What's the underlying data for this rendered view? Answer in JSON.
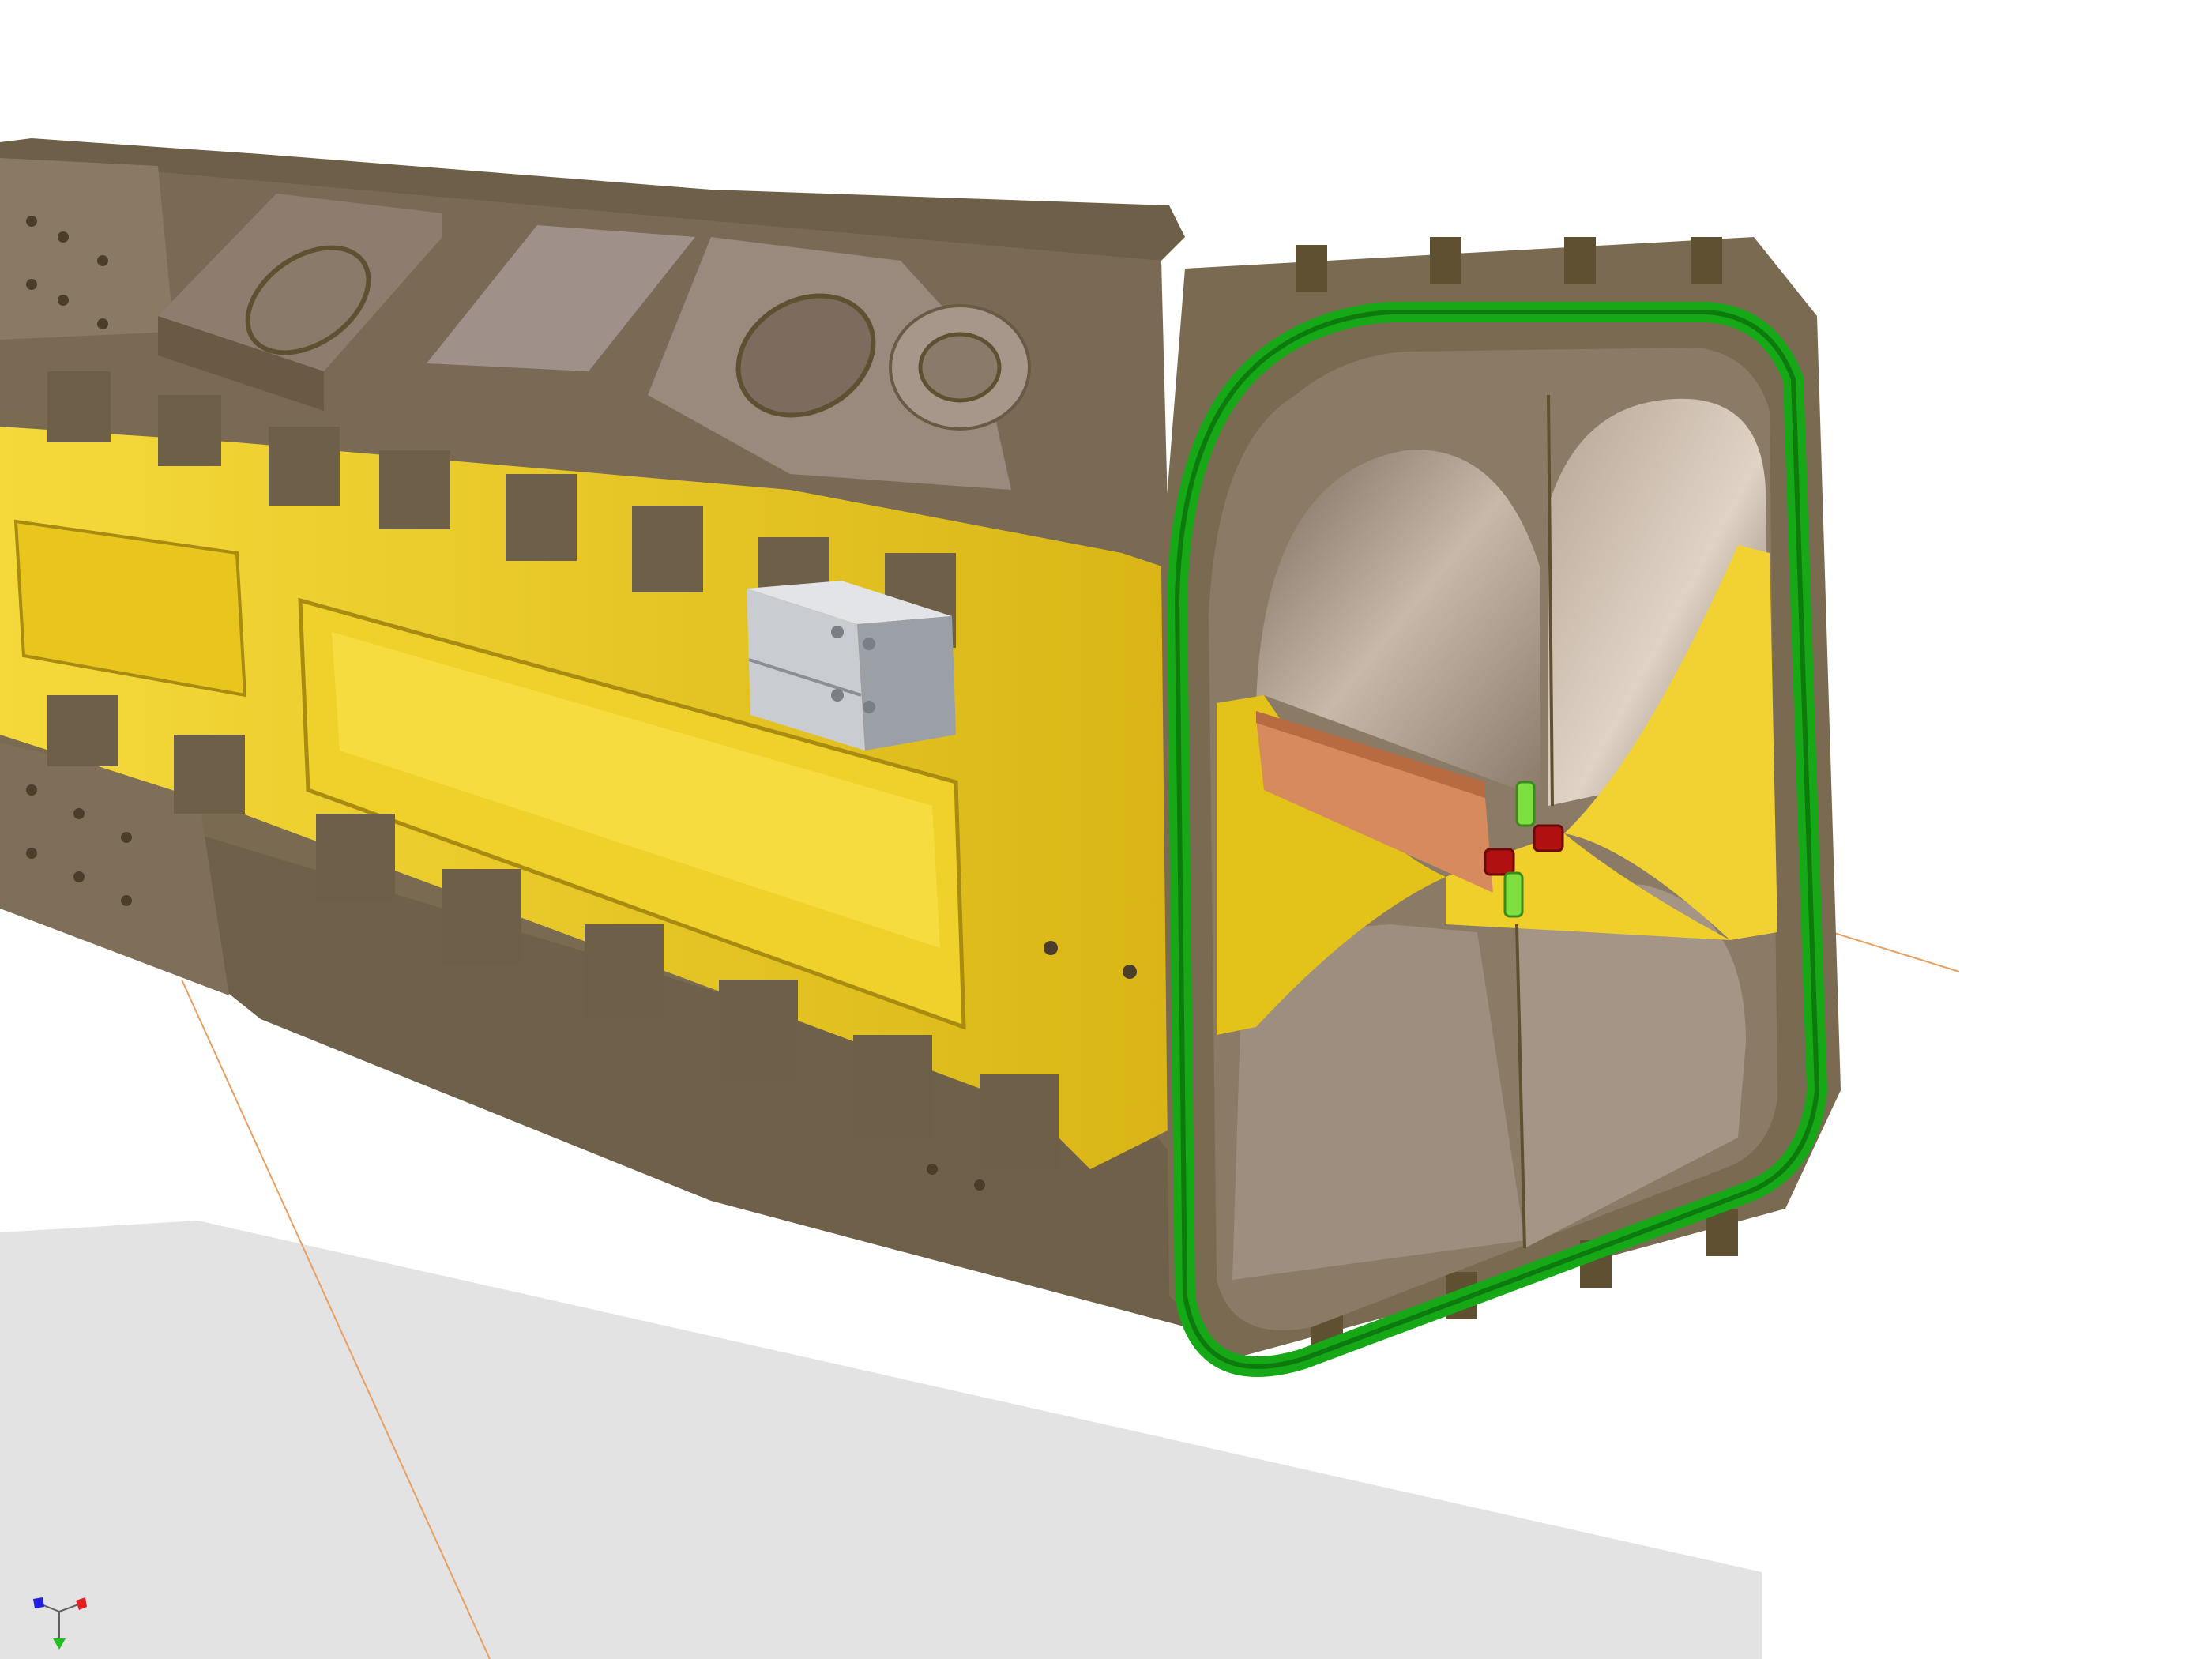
{
  "viewport": {
    "background": "#ffffff",
    "shadow_color": "#e3e3e3"
  },
  "model": {
    "part": "cryomodule-collar-quadrupole-section",
    "colors": {
      "body_top_face": "#9b8a7c",
      "body_face": "#8a7965",
      "body_dark": "#5f5032",
      "body_mid": "#7a6a52",
      "yellow_light": "#f2d233",
      "yellow_mid": "#e3c21a",
      "yellow_dark": "#c7a70f",
      "bore_light": "#b7a89c",
      "bore_dark": "#6e6054",
      "gasket_green": "#18b818",
      "gasket_green_dark": "#0d7a0d",
      "copper": "#d68a5e",
      "red_beam_tube": "#b01010",
      "green_tab": "#7ee040",
      "gray_block": "#c9ccd0",
      "gray_block_dark": "#9aa0a6",
      "construction_line": "#e8a060"
    },
    "icons": {
      "axis_triad": "xyz-axis-triad-icon"
    }
  },
  "axis_triad": {
    "x_color": "#e02020",
    "y_color": "#20c020",
    "z_color": "#2020e0"
  }
}
